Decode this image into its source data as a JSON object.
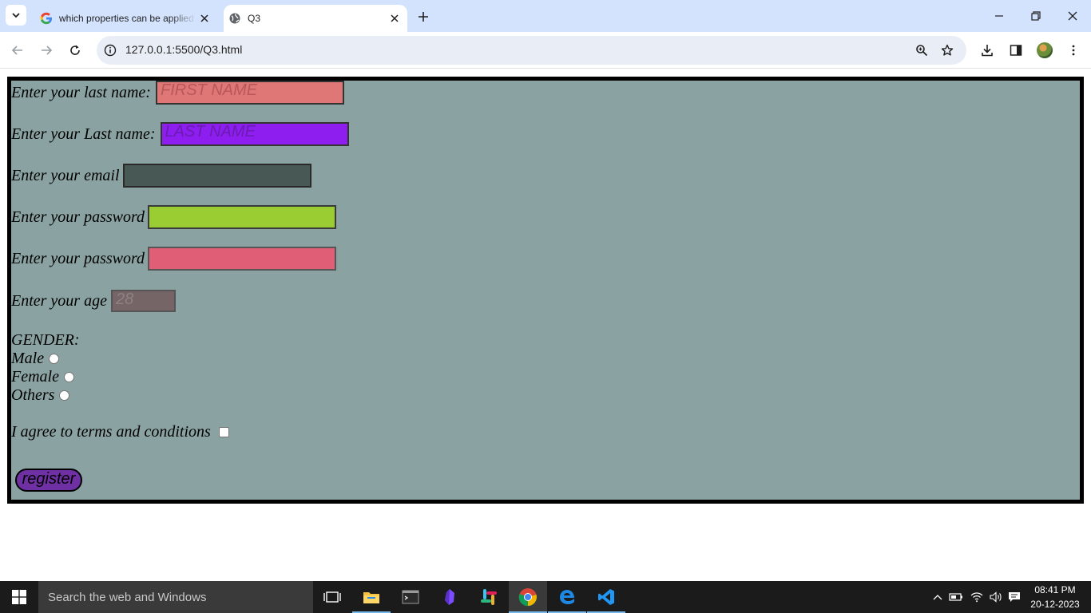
{
  "browser": {
    "tabs": [
      {
        "title": "which properties can be applied",
        "favicon": "google-icon"
      },
      {
        "title": "Q3",
        "favicon": "globe-icon"
      }
    ],
    "url": "127.0.0.1:5500/Q3.html"
  },
  "form": {
    "first_name_label": "Enter your last name:",
    "first_name_placeholder": "FIRST NAME",
    "last_name_label": "Enter your Last name:",
    "last_name_placeholder": "LAST NAME",
    "email_label": "Enter your email",
    "password_label": "Enter your password",
    "confirm_password_label": "Enter your password",
    "age_label": "Enter your age",
    "age_placeholder": "28",
    "gender_label": "GENDER:",
    "gender_options": [
      "Male",
      "Female",
      "Others"
    ],
    "terms_label": "I agree to terms and conditions",
    "register_label": "register",
    "colors": {
      "form_background": "#8aa3a2",
      "first_name_bg": "#e07777",
      "last_name_bg": "#8e1ef0",
      "email_bg": "#485955",
      "password_bg": "#9acd32",
      "confirm_password_bg": "#e05f76",
      "age_bg": "#756566",
      "register_bg": "#6f30a4"
    }
  },
  "taskbar": {
    "search_placeholder": "Search the web and Windows",
    "time": "08:41 PM",
    "date": "20-12-2023"
  }
}
